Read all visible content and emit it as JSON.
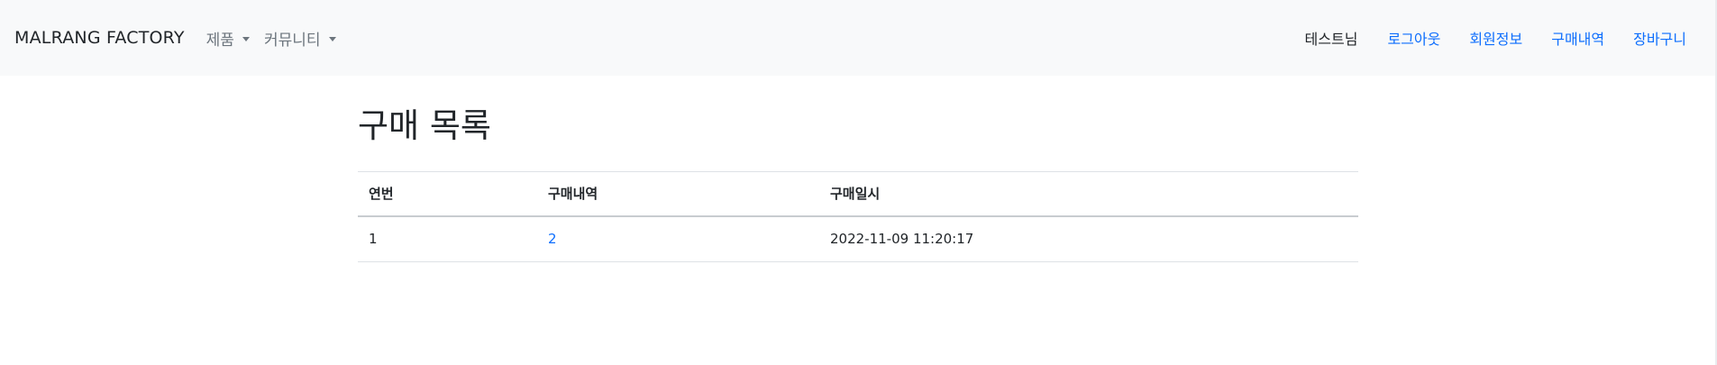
{
  "navbar": {
    "brand": "MALRANG FACTORY",
    "menus": [
      {
        "label": "제품"
      },
      {
        "label": "커뮤니티"
      }
    ],
    "user_greeting": "테스트님",
    "links": [
      {
        "label": "로그아웃"
      },
      {
        "label": "회원정보"
      },
      {
        "label": "구매내역"
      },
      {
        "label": "장바구니"
      }
    ]
  },
  "main": {
    "title": "구매 목록",
    "table": {
      "headers": [
        "연번",
        "구매내역",
        "구매일시"
      ],
      "rows": [
        {
          "index": "1",
          "purchase": "2",
          "date": "2022-11-09 11:20:17"
        }
      ]
    }
  },
  "colors": {
    "navbar_bg": "#f8f9fa",
    "link": "#0d6efd",
    "muted": "#6c757d",
    "text": "#212529"
  }
}
